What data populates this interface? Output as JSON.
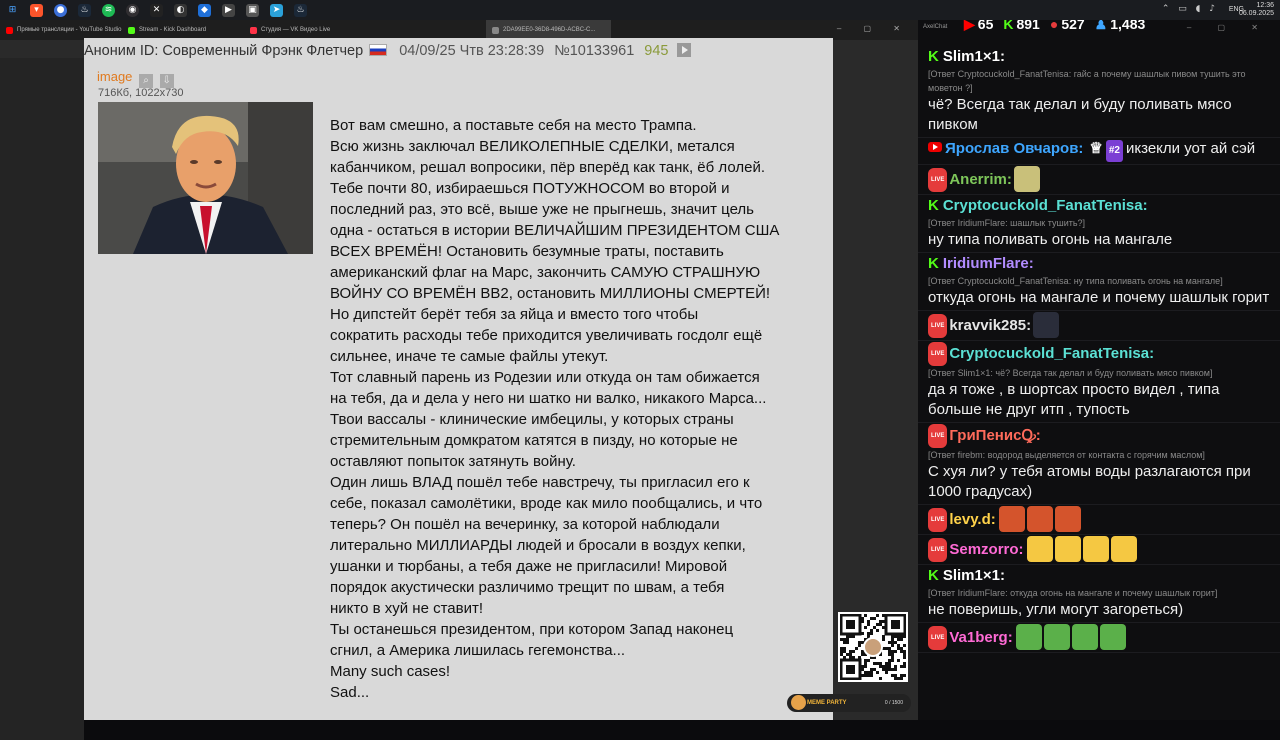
{
  "taskbar": {
    "icons": [
      "windows-icon",
      "brave-icon",
      "chrome-icon",
      "steam-icon",
      "spotify-icon",
      "obs-icon",
      "capcut-icon",
      "app-icon",
      "app2-icon",
      "app3-icon",
      "telegram-icon",
      "steam2-icon"
    ],
    "clock_time": "12:36",
    "clock_date": "06.09.2025",
    "lang": "ENG"
  },
  "browser": {
    "tabs": [
      {
        "label": "Прямые трансляции - YouTube Studio",
        "color": "#ff0000"
      },
      {
        "label": "Stream - Kick Dashboard",
        "color": "#53fc18"
      },
      {
        "label": "Студия — VK Видео Live",
        "color": "#ff3347"
      },
      {
        "label": "2DA99EE0-36D8-496D-ACBC-C...",
        "color": "#888888"
      }
    ]
  },
  "post": {
    "anon": "Аноним ID:",
    "name": "Современный Фрэнк Флетчер",
    "date": "04/09/25 Чтв 23:28:39",
    "number": "№10133961",
    "replies": "945",
    "image_link": "image",
    "image_meta": "716Кб, 1022x730",
    "lines": [
      "Вот вам смешно, а поставьте себя на место Трампа.",
      "Всю жизнь заключал ВЕЛИКОЛЕПНЫЕ СДЕЛКИ, метался",
      "кабанчиком, решал вопросики, пёр вперёд как танк, ёб лолей.",
      "Тебе почти 80, избираешься ПОТУЖНОСОМ во второй и",
      "последний раз, это всё, выше уже не прыгнешь, значит цель",
      "одна - остаться в истории ВЕЛИЧАЙШИМ ПРЕЗИДЕНТОМ США",
      "ВСЕХ ВРЕМЁН! Остановить безумные траты, поставить",
      "американский флаг на Марс, закончить САМУЮ СТРАШНУЮ",
      "ВОЙНУ СО ВРЕМЁН ВВ2, остановить МИЛЛИОНЫ СМЕРТЕЙ!",
      "Но дипстейт берёт тебя за яйца и вместо того чтобы",
      "сократить расходы тебе приходится увеличивать госдолг ещё",
      "сильнее, иначе те самые файлы утекут.",
      "Тот славный парень из Родезии или откуда он там обижается",
      "на тебя, да и дела у него ни шатко ни валко, никакого Марса...",
      "Твои вассалы - клинические имбецилы, у которых страны",
      "стремительным домкратом катятся в пизду, но которые не",
      "оставляют попыток затянуть войну.",
      "Один лишь ВЛАД пошёл тебе навстречу, ты пригласил его к",
      "себе, показал самолётики, вроде как мило пообщались, и что",
      "теперь? Он пошёл на вечеринку, за которой наблюдали",
      "литерально МИЛЛИАРДЫ людей и бросали в воздух кепки,",
      "ушанки и тюрбаны, а тебя даже не пригласили! Мировой",
      "порядок акустически различимо трещит по швам, а тебя",
      "никто в хуй не ставит!",
      "Ты останешься президентом, при котором Запад наконец",
      "сгнил, а Америка лишилась гегемонства...",
      "Many such cases!",
      "Sad..."
    ]
  },
  "overlay": {
    "meme_label": "MEME PARTY",
    "meme_count": "0 / 1500"
  },
  "chat": {
    "window_title": "AxelChat",
    "stats": [
      {
        "icon": "youtube-icon",
        "value": "65",
        "color": "#ff0000"
      },
      {
        "icon": "kick-icon",
        "value": "891",
        "color": "#53fc18"
      },
      {
        "icon": "vk-icon",
        "value": "527",
        "color": "#e53b3b"
      },
      {
        "icon": "viewers-icon",
        "value": "1,483",
        "color": "#3ea6ff"
      }
    ],
    "messages": [
      {
        "platform": "kick",
        "author": "Slim1×1:",
        "color": "#ffffff",
        "reply": "[Ответ Cryptocuckold_FanatTenisa: гайс а почему шашлык пивом тушить это моветон ?]",
        "text": "чё? Всегда так делал и буду поливать мясо пивком"
      },
      {
        "platform": "youtube",
        "author": "Ярослав Овчаров:",
        "color": "#3ea6ff",
        "badge": "#2",
        "text": "икзекли уот ай сэй"
      },
      {
        "platform": "vk",
        "author": "Anerrim:",
        "color": "#7ec65a",
        "emote": "#c9c07a"
      },
      {
        "platform": "kick",
        "author": "Cryptocuckold_FanatTenisa:",
        "color": "#5be0d4",
        "reply": "[Ответ IridiumFlare: шашлык тушить?]",
        "text": "ну типа поливать огонь на мангале"
      },
      {
        "platform": "kick",
        "author": "IridiumFlare:",
        "color": "#b28cff",
        "reply": "[Ответ Cryptocuckold_FanatTenisa: ну типа поливать огонь на мангале]",
        "text": "откуда огонь на мангале и почему шашлык горит"
      },
      {
        "platform": "vk",
        "author": "kravvik285:",
        "color": "#e6e6e6",
        "emote": "#2a2d3a"
      },
      {
        "platform": "vk",
        "author": "Cryptocuckold_FanatTenisa:",
        "color": "#5be0d4",
        "reply": "[Ответ Slim1×1: чё? Всегда так делал и буду поливать мясо пивком]",
        "text": "да я тоже , в шортсах просто видел , типа больше не друг итп , тупость"
      },
      {
        "platform": "vk",
        "author": "ГриПенисꝘ:",
        "color": "#ff6b5b",
        "reply": "[Ответ firebm: водород выделяется от контакта с горячим маслом]",
        "text": "С хуя ли? у тебя атомы воды разлагаются при 1000 градусах)"
      },
      {
        "platform": "vk",
        "author": "levy.d:",
        "color": "#ffd24a",
        "emote": "#d4542c",
        "emote_count": 3
      },
      {
        "platform": "vk",
        "author": "Semzorro:",
        "color": "#ff6ad5",
        "emote": "#f5c842",
        "emote_count": 4
      },
      {
        "platform": "kick",
        "author": "Slim1×1:",
        "color": "#ffffff",
        "reply": "[Ответ IridiumFlare: откуда огонь на мангале и почему шашлык горит]",
        "text": "не поверишь, угли могут загореться)"
      },
      {
        "platform": "vk",
        "author": "Va1berg:",
        "color": "#ff6ad5",
        "emote": "#5bb04a",
        "emote_count": 4
      }
    ]
  }
}
